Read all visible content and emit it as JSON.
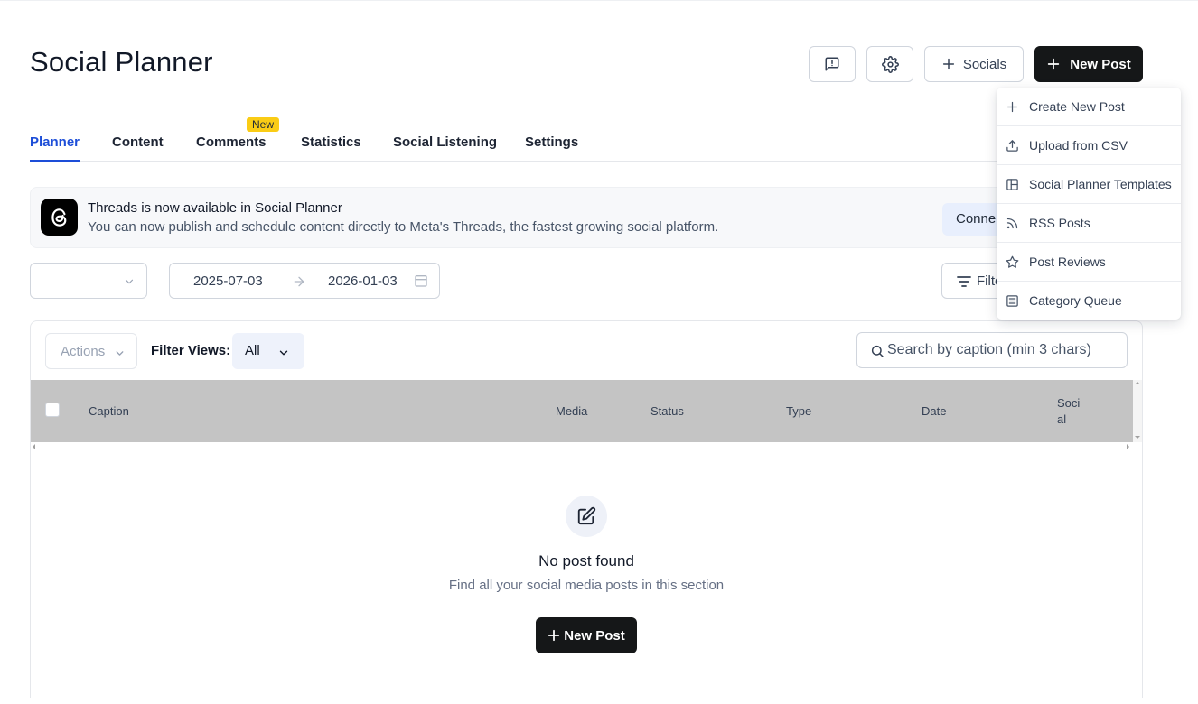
{
  "header": {
    "title": "Social Planner",
    "socials_label": "Socials",
    "new_post_label": "New Post",
    "icons": [
      "feedback-icon",
      "gear-icon",
      "plus-icon"
    ]
  },
  "tabs": [
    {
      "label": "Planner",
      "active": true
    },
    {
      "label": "Content"
    },
    {
      "label": "Comments",
      "badge": "New"
    },
    {
      "label": "Statistics"
    },
    {
      "label": "Social Listening"
    },
    {
      "label": "Settings"
    }
  ],
  "banner": {
    "title": "Threads is now available in Social Planner",
    "text": "You can now publish and schedule content directly to Meta's Threads, the fastest growing social platform.",
    "connect_label": "Conne"
  },
  "toolbar": {
    "account_select": "",
    "date_start": "2025-07-03",
    "date_end": "2026-01-03",
    "filters_label": "Filte"
  },
  "table": {
    "actions_label": "Actions",
    "filter_views_label": "Filter Views:",
    "filter_views_value": "All",
    "search_placeholder": "Search by caption (min 3 chars)",
    "columns": [
      "Caption",
      "Media",
      "Status",
      "Type",
      "Date",
      "Soci",
      "al"
    ]
  },
  "empty_state": {
    "title": "No post found",
    "subtitle": "Find all your social media posts in this section",
    "button_label": "New Post"
  },
  "dropdown": {
    "items": [
      {
        "label": "Create New Post",
        "icon": "plus-icon"
      },
      {
        "label": "Upload from CSV",
        "icon": "upload-icon"
      },
      {
        "label": "Social Planner Templates",
        "icon": "template-icon"
      },
      {
        "label": "RSS Posts",
        "icon": "rss-icon"
      },
      {
        "label": "Post Reviews",
        "icon": "star-icon"
      },
      {
        "label": "Category Queue",
        "icon": "list-icon"
      }
    ]
  },
  "colors": {
    "accent": "#1d4ed8",
    "primary_button": "#151718",
    "badge": "#facc15",
    "table_header": "#c4c4c4"
  }
}
